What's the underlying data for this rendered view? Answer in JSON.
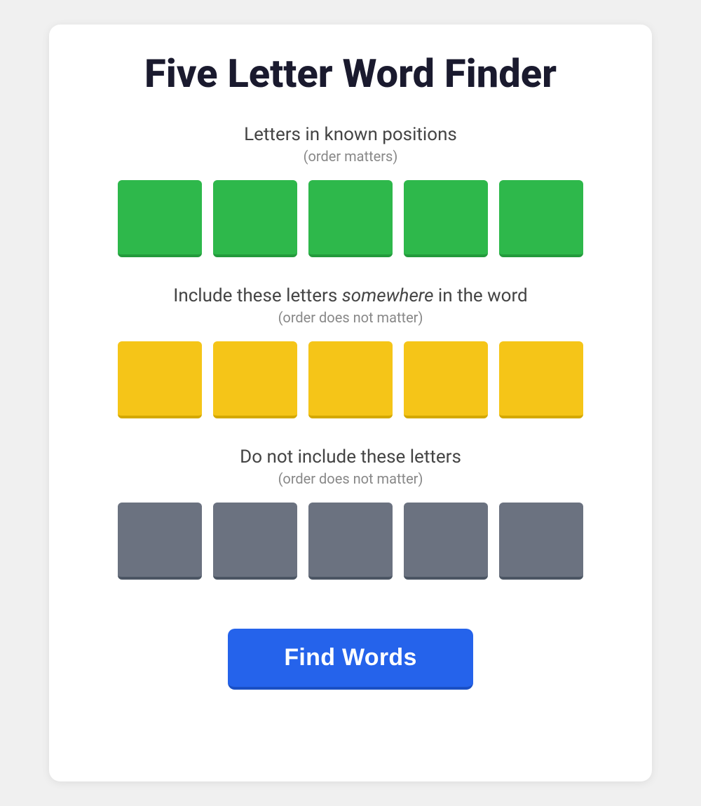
{
  "page": {
    "title": "Five Letter Word Finder",
    "background_color": "#f0f0f0"
  },
  "sections": {
    "known_positions": {
      "title": "Letters in known positions",
      "subtitle": "(order matters)",
      "boxes": [
        {
          "value": "",
          "color": "green"
        },
        {
          "value": "",
          "color": "green"
        },
        {
          "value": "",
          "color": "green"
        },
        {
          "value": "",
          "color": "green"
        },
        {
          "value": "",
          "color": "green"
        }
      ]
    },
    "somewhere": {
      "title_prefix": "Include these letters ",
      "title_italic": "somewhere",
      "title_suffix": " in the word",
      "subtitle": "(order does not matter)",
      "boxes": [
        {
          "value": "",
          "color": "yellow"
        },
        {
          "value": "",
          "color": "yellow"
        },
        {
          "value": "",
          "color": "yellow"
        },
        {
          "value": "",
          "color": "yellow"
        },
        {
          "value": "",
          "color": "yellow"
        }
      ]
    },
    "exclude": {
      "title": "Do not include these letters",
      "subtitle": "(order does not matter)",
      "boxes": [
        {
          "value": "",
          "color": "gray"
        },
        {
          "value": "",
          "color": "gray"
        },
        {
          "value": "",
          "color": "gray"
        },
        {
          "value": "",
          "color": "gray"
        },
        {
          "value": "",
          "color": "gray"
        }
      ]
    }
  },
  "button": {
    "label": "Find Words"
  }
}
